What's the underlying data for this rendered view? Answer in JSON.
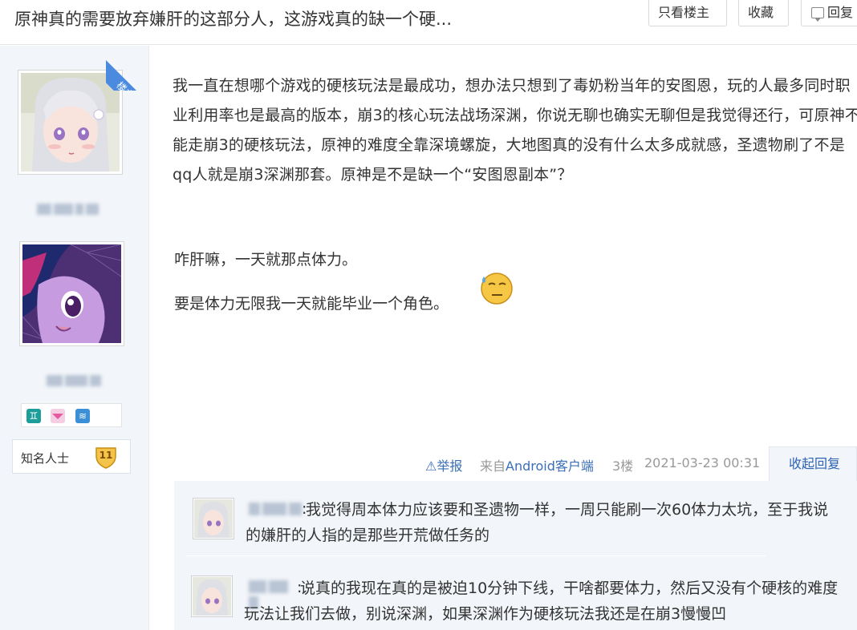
{
  "header": {
    "title": "原神真的需要放弃嫌肝的这部分人，这游戏真的缺一个硬...",
    "btn_louzhu": "只看楼主",
    "btn_collect": "收藏",
    "btn_reply": "回复"
  },
  "sidebar": {
    "ribbon": "楼主",
    "level_title": "知名人士",
    "level_num": "11",
    "badge_gem": "♊",
    "badge_water": "≋"
  },
  "post": {
    "paragraph1": "我一直在想哪个游戏的硬核玩法是最成功，想办法只想到了毒奶粉当年的安图恩，玩的人最多同时职业利用率也是最高的版本，崩3的核心玩法战场深渊，你说无聊也确实无聊但是我觉得还行，可原神不能走崩3的硬核玩法，原神的难度全靠深境螺旋，大地图真的没有什么太多成就感，圣遗物刷了不是qq人就是崩3深渊那套。原神是不是缺一个“安图恩副本”？",
    "paragraph2": "咋肝嘛，一天就那点体力。",
    "paragraph3": "要是体力无限我一天就能毕业一个角色。"
  },
  "tail": {
    "report": "⚠举报",
    "from_prefix": "来自",
    "from_client": "Android客户端",
    "floor": "3楼",
    "time": "2021-03-23 00:31",
    "collapse": "收起回复"
  },
  "replies": [
    {
      "text": "我觉得周本体力应该要和圣遗物一样，一周只能刷一次60体力太坑，至于我说的嫌肝的人指的是那些开荒做任务的"
    },
    {
      "text": "说真的我现在真的是被迫10分钟下线，干啥都要体力，然后又没有个硬核的难度玩法让我们去做，别说深渊，如果深渊作为硬核玩法我还是在崩3慢慢凹"
    }
  ]
}
